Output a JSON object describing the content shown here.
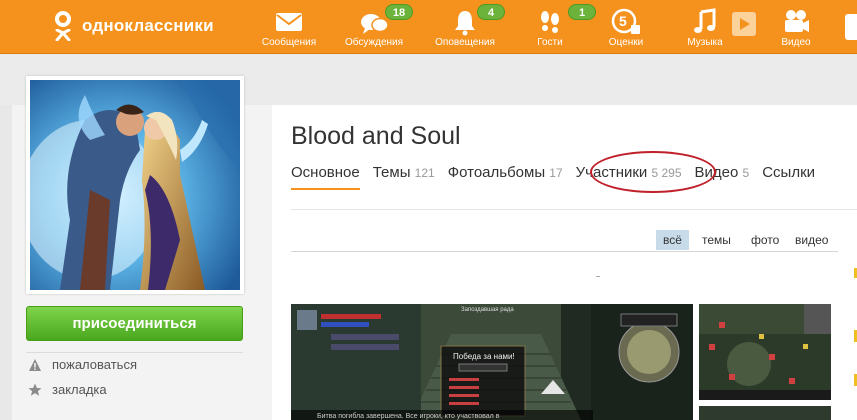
{
  "header": {
    "logo_text": "одноклассники",
    "nav": [
      {
        "id": "messages",
        "label": "Сообщения",
        "icon": "envelope-icon",
        "badge": ""
      },
      {
        "id": "discussions",
        "label": "Обсуждения",
        "icon": "speech-bubbles-icon",
        "badge": "18"
      },
      {
        "id": "notifications",
        "label": "Оповещения",
        "icon": "bell-icon",
        "badge": "4"
      },
      {
        "id": "guests",
        "label": "Гости",
        "icon": "footprints-icon",
        "badge": "1"
      },
      {
        "id": "ratings",
        "label": "Оценки",
        "icon": "five-plus-icon",
        "badge": ""
      },
      {
        "id": "music",
        "label": "Музыка",
        "icon": "music-note-icon",
        "badge": ""
      },
      {
        "id": "video",
        "label": "Видео",
        "icon": "film-camera-icon",
        "badge": ""
      }
    ]
  },
  "sidebar": {
    "join_label": "присоединиться",
    "links": [
      {
        "label": "пожаловаться",
        "icon": "warning-icon"
      },
      {
        "label": "закладка",
        "icon": "star-icon"
      }
    ]
  },
  "group": {
    "title": "Blood and Soul",
    "tabs": [
      {
        "label": "Основное",
        "count": "",
        "active": true
      },
      {
        "label": "Темы",
        "count": "121",
        "active": false
      },
      {
        "label": "Фотоальбомы",
        "count": "17",
        "active": false
      },
      {
        "label": "Участники",
        "count": "5 295",
        "active": false
      },
      {
        "label": "Видео",
        "count": "5",
        "active": false
      },
      {
        "label": "Ссылки",
        "count": "",
        "active": false
      }
    ],
    "filters": [
      {
        "label": "всё",
        "selected": true
      },
      {
        "label": "темы",
        "selected": false
      },
      {
        "label": "фото",
        "selected": false
      },
      {
        "label": "видео",
        "selected": false
      }
    ]
  },
  "feed": {
    "screenshot_texts": {
      "victory": "Победа за нами!",
      "caption": "Битва погибла завершена. Все игроки, кто участвовал в",
      "popup_title": "Запоздавшая рада"
    }
  },
  "colors": {
    "topbar": "#f5921e",
    "badge": "#6bb33a",
    "join": "#5cb82c",
    "highlight": "#c0202a",
    "active_tab": "#f5921e"
  }
}
